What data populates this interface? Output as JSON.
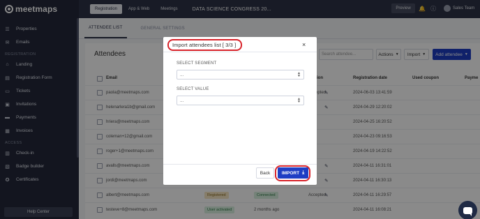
{
  "app": {
    "logo_text": "meetmaps"
  },
  "sidebar": {
    "items_top": [
      {
        "label": "Properties",
        "icon": "list-icon"
      },
      {
        "label": "Emails",
        "icon": "mail-icon"
      }
    ],
    "section_registration": "REGISTRATION",
    "items_registration": [
      {
        "label": "Landing",
        "icon": "home-icon"
      },
      {
        "label": "Registration Form",
        "icon": "form-icon"
      },
      {
        "label": "Tickets",
        "icon": "ticket-icon"
      },
      {
        "label": "Invitations",
        "icon": "invitation-icon"
      },
      {
        "label": "Payments",
        "icon": "card-icon"
      },
      {
        "label": "Invoices",
        "icon": "invoice-icon"
      }
    ],
    "section_access": "ACCESS",
    "items_access": [
      {
        "label": "Check-in",
        "icon": "checkin-icon"
      },
      {
        "label": "Badge builder",
        "icon": "badge-icon"
      },
      {
        "label": "Certificates",
        "icon": "certificate-icon"
      }
    ],
    "help_center": "Help Center"
  },
  "topbar": {
    "tabs": [
      "Registration",
      "App & Web",
      "Meetings"
    ],
    "event_title": "DATA SCIENCE CONGRESS 20...",
    "preview": "Preview",
    "user_name": "Sales Team"
  },
  "subtabs": [
    "ATTENDEE LIST",
    "GENERAL SETTINGS"
  ],
  "attendees": {
    "title": "Attendees",
    "search_placeholder": "Search attendee...",
    "actions": "Actions",
    "import": "Import",
    "add_attendee": "Add attendee",
    "columns": [
      "Email",
      "ion",
      "Registration date",
      "Used coupon",
      "Payme"
    ],
    "rows": [
      {
        "email": "paola@meetmaps.com",
        "status": "Accepted",
        "date": "2024-06-03 13:41:59"
      },
      {
        "email": "helenarlera1b@gmail.com",
        "status": "",
        "date": "2024-04-29 12:20:02"
      },
      {
        "email": "hriera@meetmaps.com",
        "status": "",
        "date": "2024-04-25 16:20:52"
      },
      {
        "email": "coleman+12@gmail.com",
        "status": "",
        "date": "2024-04-23 09:16:53"
      },
      {
        "email": "roger+1@meetmaps.com",
        "status": "",
        "date": "2024-04-19 14:22:52"
      },
      {
        "email": "avalls@meetmaps.com",
        "status": "",
        "date": "2024-04-11 16:31:01"
      },
      {
        "email": "jordi@meetmaps.com",
        "status": "",
        "date": "2024-04-11 16:30:13"
      },
      {
        "email": "albert@meetmaps.com",
        "pill1": "Registered",
        "pill2": "Connected",
        "status": "Accepted",
        "date": "2024-04-11 16:29:57"
      },
      {
        "email": "testeve+8@meetmaps.com",
        "pill1": "User activated",
        "ago": "2 months ago",
        "date": "2024-04-11 16:08:21"
      }
    ]
  },
  "modal": {
    "title": "Import attendees list [ 3/3 ]",
    "close": "×",
    "segment_label": "SELECT SEGMENT",
    "segment_value": "...",
    "value_label": "SELECT VALUE",
    "value_value": "...",
    "back": "Back",
    "import": "IMPORT"
  },
  "colors": {
    "accent": "#1f3ec4",
    "highlight": "#d8232a",
    "sidebar": "#23283a"
  }
}
